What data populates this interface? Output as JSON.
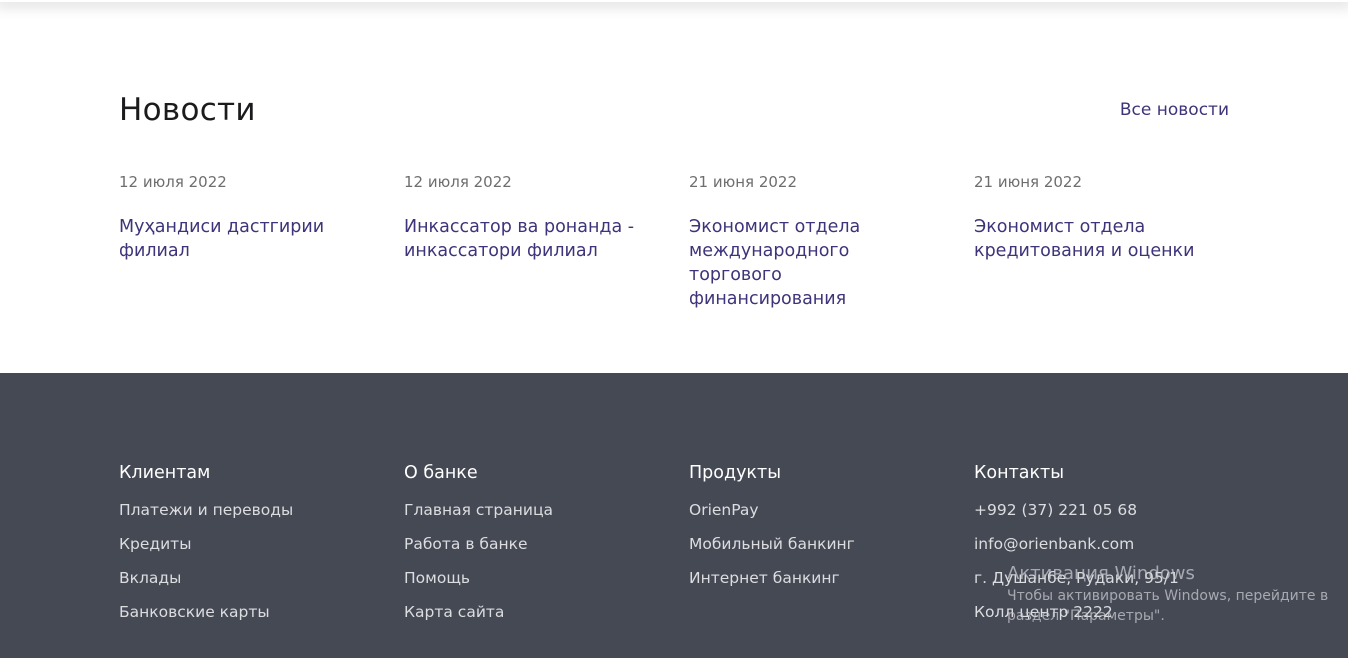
{
  "news": {
    "title": "Новости",
    "all_link": "Все новости",
    "items": [
      {
        "date": "12 июля 2022",
        "title": "Муҳандиси дастгирии филиал"
      },
      {
        "date": "12 июля 2022",
        "title": "Инкассатор ва ронанда - инкассатори филиал"
      },
      {
        "date": "21 июня 2022",
        "title": "Экономист отдела международного торгового финансирования"
      },
      {
        "date": "21 июня 2022",
        "title": "Экономист отдела кредитования и оценки"
      }
    ]
  },
  "footer": {
    "columns": [
      {
        "title": "Клиентам",
        "links": [
          "Платежи и переводы",
          "Кредиты",
          "Вклады",
          "Банковские карты"
        ]
      },
      {
        "title": "О банке",
        "links": [
          "Главная страница",
          "Работа в банке",
          "Помощь",
          "Карта сайта"
        ]
      },
      {
        "title": "Продукты",
        "links": [
          "OrienPay",
          "Мобильный банкинг",
          "Интернет банкинг"
        ]
      },
      {
        "title": "Контакты",
        "links": [
          "+992 (37) 221 05 68",
          "info@orienbank.com",
          "г. Душанбе, Рудаки, 95/1",
          "Колл центр 2222"
        ]
      }
    ]
  },
  "watermark": {
    "title": "Активация Windows",
    "text": "Чтобы активировать Windows, перейдите в раздел \"Параметры\"."
  },
  "colors": {
    "accent": "#3d3479",
    "footer_bg": "#454954",
    "heading": "#1b1b1d",
    "date": "#6e6e6e"
  }
}
